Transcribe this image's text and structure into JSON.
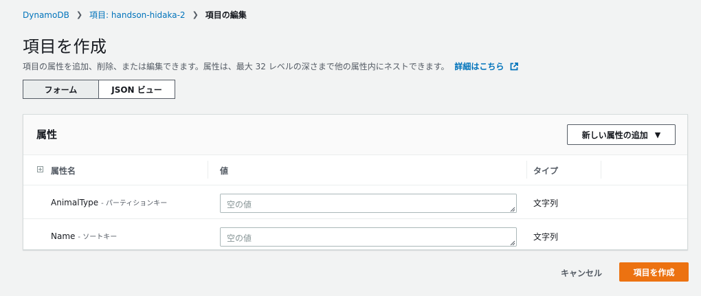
{
  "breadcrumb": {
    "items": [
      {
        "label": "DynamoDB"
      },
      {
        "label": "項目: handson-hidaka-2"
      },
      {
        "label": "項目の編集"
      }
    ]
  },
  "page": {
    "title": "項目を作成",
    "description": "項目の属性を追加、削除、または編集できます。属性は、最大 32 レベルの深さまで他の属性内にネストできます。",
    "learn_more": "詳細はこちら"
  },
  "view_toggle": {
    "form": "フォーム",
    "json": "JSON ビュー",
    "selected": "フォーム"
  },
  "attributes_panel": {
    "title": "属性",
    "add_button": "新しい属性の追加",
    "columns": {
      "name": "属性名",
      "value": "値",
      "type": "タイプ"
    },
    "rows": [
      {
        "name": "AnimalType",
        "hint": "- パーティションキー",
        "placeholder": "空の値",
        "type": "文字列"
      },
      {
        "name": "Name",
        "hint": "- ソートキー",
        "placeholder": "空の値",
        "type": "文字列"
      }
    ]
  },
  "actions": {
    "cancel": "キャンセル",
    "create": "項目を作成"
  },
  "colors": {
    "link": "#0073bb",
    "primary": "#ec7211",
    "background": "#f2f3f3"
  }
}
